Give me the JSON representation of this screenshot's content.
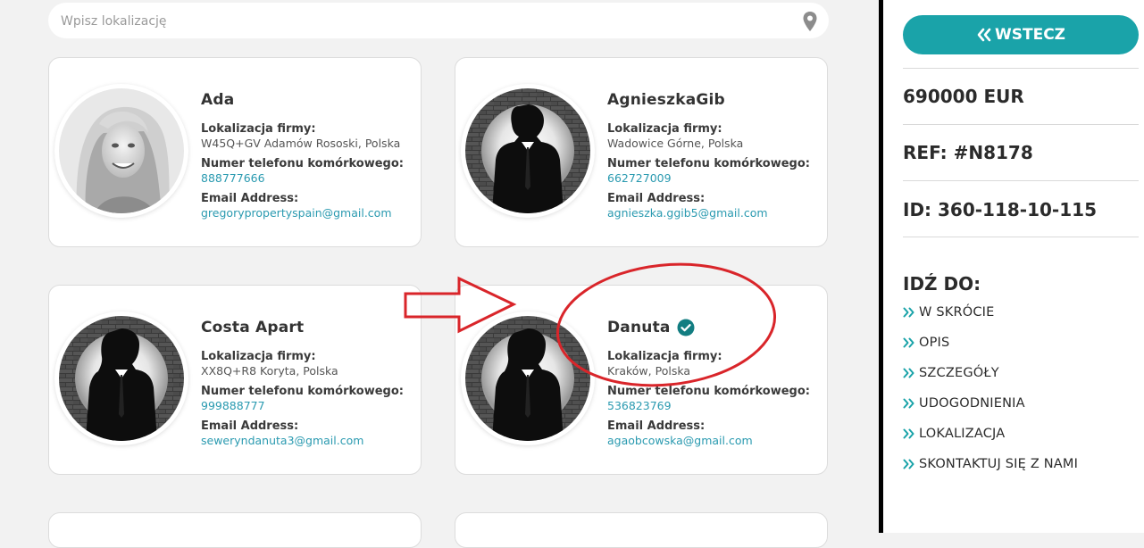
{
  "search": {
    "placeholder": "Wpisz lokalizację"
  },
  "labels": {
    "location": "Lokalizacja firmy:",
    "phone": "Numer telefonu komórkowego:",
    "email": "Email Address:"
  },
  "agents": [
    {
      "name": "Ada",
      "location": "W45Q+GV Adamów Rososki, Polska",
      "phone": "888777666",
      "email": "gregorypropertyspain@gmail.com",
      "avatar": "woman-portrait",
      "verified": false
    },
    {
      "name": "AgnieszkaGib",
      "location": "Wadowice Górne, Polska",
      "phone": "662727009",
      "email": "agnieszka.ggib5@gmail.com",
      "avatar": "man-silhouette",
      "verified": false
    },
    {
      "name": "Costa Apart",
      "location": "XX8Q+R8 Koryta, Polska",
      "phone": "999888777",
      "email": "seweryndanuta3@gmail.com",
      "avatar": "man-silhouette",
      "verified": false
    },
    {
      "name": "Danuta",
      "location": "Kraków, Polska",
      "phone": "536823769",
      "email": "agaobcowska@gmail.com",
      "avatar": "man-silhouette",
      "verified": true
    }
  ],
  "sidebar": {
    "back_label": "WSTECZ",
    "price": "690000 EUR",
    "ref": "REF: #N8178",
    "id": "ID: 360-118-10-115",
    "goto_title": "IDŹ DO:",
    "nav": [
      "W SKRÓCIE",
      "OPIS",
      "SZCZEGÓŁY",
      "UDOGODNIENIA",
      "LOKALIZACJA",
      "SKONTAKTUJ SIĘ Z NAMI"
    ]
  },
  "colors": {
    "accent": "#1aa3a9",
    "link": "#2a9ab0",
    "annotation": "#d9252a",
    "verified_badge": "#127d81"
  }
}
